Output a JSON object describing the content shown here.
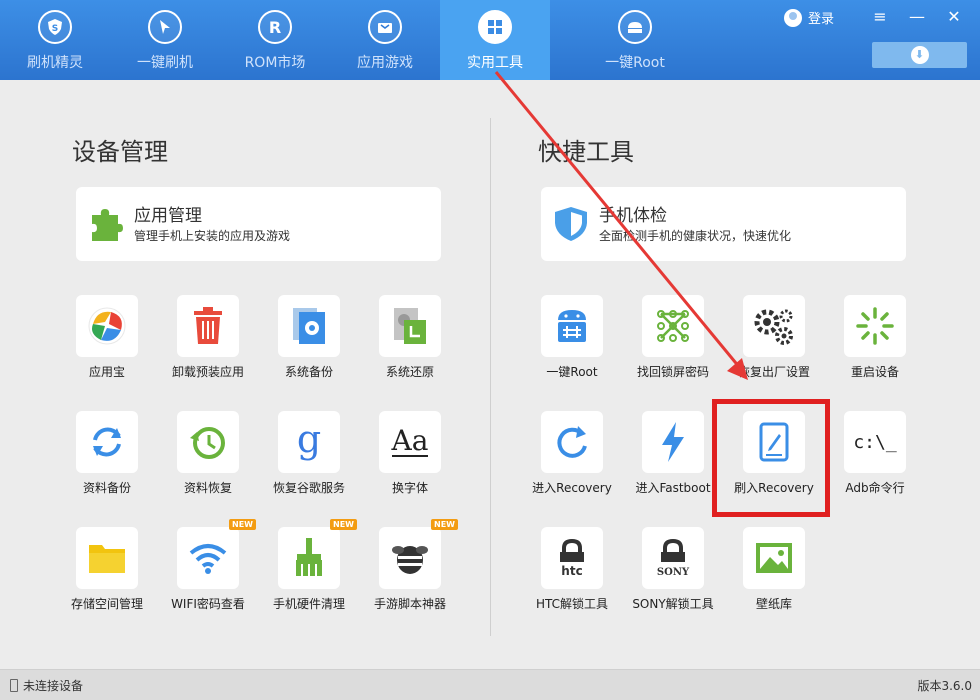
{
  "nav": {
    "tabs": [
      {
        "label": "刷机精灵",
        "icon": "shield-icon"
      },
      {
        "label": "一键刷机",
        "icon": "cursor-icon"
      },
      {
        "label": "ROM市场",
        "icon": "rom-icon"
      },
      {
        "label": "应用游戏",
        "icon": "bag-icon"
      },
      {
        "label": "实用工具",
        "icon": "grid-icon"
      },
      {
        "label": "一键Root",
        "icon": "android-icon"
      }
    ],
    "active_tab": "实用工具",
    "login_label": "登录"
  },
  "device_mgmt": {
    "title": "设备管理",
    "card": {
      "title": "应用管理",
      "desc": "管理手机上安装的应用及游戏"
    },
    "tools": [
      {
        "label": "应用宝"
      },
      {
        "label": "卸载预装应用"
      },
      {
        "label": "系统备份"
      },
      {
        "label": "系统还原"
      },
      {
        "label": "资料备份"
      },
      {
        "label": "资料恢复"
      },
      {
        "label": "恢复谷歌服务"
      },
      {
        "label": "换字体"
      },
      {
        "label": "存储空间管理"
      },
      {
        "label": "WIFI密码查看",
        "badge": "NEW"
      },
      {
        "label": "手机硬件清理",
        "badge": "NEW"
      },
      {
        "label": "手游脚本神器",
        "badge": "NEW"
      }
    ]
  },
  "quick_tools": {
    "title": "快捷工具",
    "card": {
      "title": "手机体检",
      "desc": "全面检测手机的健康状况，快速优化"
    },
    "tools": [
      {
        "label": "一键Root"
      },
      {
        "label": "找回锁屏密码"
      },
      {
        "label": "恢复出厂设置"
      },
      {
        "label": "重启设备"
      },
      {
        "label": "进入Recovery"
      },
      {
        "label": "进入Fastboot"
      },
      {
        "label": "刷入Recovery"
      },
      {
        "label": "Adb命令行",
        "icon_text": "c:\\_"
      },
      {
        "label": "HTC解锁工具",
        "icon_text": "htc"
      },
      {
        "label": "SONY解锁工具",
        "icon_text": "SONY"
      },
      {
        "label": "壁纸库"
      }
    ]
  },
  "footer": {
    "status": "未连接设备",
    "version": "版本3.6.0"
  },
  "colors": {
    "topbar": "#2c74cf",
    "active_tab": "#4aa3f1",
    "highlight": "#e02020",
    "background": "#ececec"
  }
}
